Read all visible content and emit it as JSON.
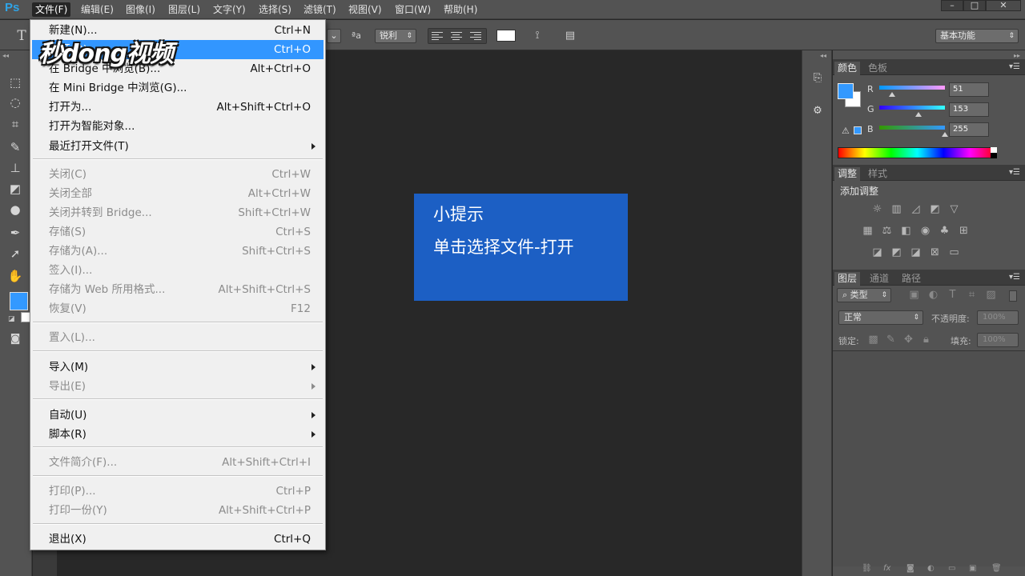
{
  "app": {
    "logo": "Ps",
    "menus": [
      "文件(F)",
      "编辑(E)",
      "图像(I)",
      "图层(L)",
      "文字(Y)",
      "选择(S)",
      "滤镜(T)",
      "视图(V)",
      "窗口(W)",
      "帮助(H)"
    ],
    "active_menu": "文件(F)",
    "window_controls": {
      "minimize": "–",
      "restore": "□",
      "close": "✕"
    }
  },
  "options_bar": {
    "text_tool": "T",
    "size_glyph": "ªa",
    "antialias": "锐利",
    "workspace": "基本功能"
  },
  "file_menu": {
    "items": [
      {
        "label": "新建(N)...",
        "shortcut": "Ctrl+N",
        "enabled": true
      },
      {
        "label": "打开(O)...",
        "shortcut": "Ctrl+O",
        "enabled": true,
        "highlighted": true
      },
      {
        "label": "在 Bridge 中浏览(B)...",
        "shortcut": "Alt+Ctrl+O",
        "enabled": true
      },
      {
        "label": "在 Mini Bridge 中浏览(G)...",
        "shortcut": "",
        "enabled": true
      },
      {
        "label": "打开为...",
        "shortcut": "Alt+Shift+Ctrl+O",
        "enabled": true
      },
      {
        "label": "打开为智能对象...",
        "shortcut": "",
        "enabled": true
      },
      {
        "label": "最近打开文件(T)",
        "shortcut": "",
        "enabled": true,
        "submenu": true
      },
      {
        "label": "关闭(C)",
        "shortcut": "Ctrl+W",
        "enabled": false
      },
      {
        "label": "关闭全部",
        "shortcut": "Alt+Ctrl+W",
        "enabled": false
      },
      {
        "label": "关闭并转到 Bridge...",
        "shortcut": "Shift+Ctrl+W",
        "enabled": false
      },
      {
        "label": "存储(S)",
        "shortcut": "Ctrl+S",
        "enabled": false
      },
      {
        "label": "存储为(A)...",
        "shortcut": "Shift+Ctrl+S",
        "enabled": false
      },
      {
        "label": "签入(I)...",
        "shortcut": "",
        "enabled": false
      },
      {
        "label": "存储为 Web 所用格式...",
        "shortcut": "Alt+Shift+Ctrl+S",
        "enabled": false
      },
      {
        "label": "恢复(V)",
        "shortcut": "F12",
        "enabled": false
      },
      {
        "label": "置入(L)...",
        "shortcut": "",
        "enabled": false
      },
      {
        "label": "导入(M)",
        "shortcut": "",
        "enabled": true,
        "submenu": true
      },
      {
        "label": "导出(E)",
        "shortcut": "",
        "enabled": false,
        "submenu": true
      },
      {
        "label": "自动(U)",
        "shortcut": "",
        "enabled": true,
        "submenu": true
      },
      {
        "label": "脚本(R)",
        "shortcut": "",
        "enabled": true,
        "submenu": true
      },
      {
        "label": "文件简介(F)...",
        "shortcut": "Alt+Shift+Ctrl+I",
        "enabled": false
      },
      {
        "label": "打印(P)...",
        "shortcut": "Ctrl+P",
        "enabled": false
      },
      {
        "label": "打印一份(Y)",
        "shortcut": "Alt+Shift+Ctrl+P",
        "enabled": false
      },
      {
        "label": "退出(X)",
        "shortcut": "Ctrl+Q",
        "enabled": true
      }
    ]
  },
  "watermark": "秒dong视频",
  "tip": {
    "title": "小提示",
    "text": "单击选择文件-打开"
  },
  "color_panel": {
    "tabs": [
      "颜色",
      "色板"
    ],
    "channels": [
      {
        "label": "R",
        "value": "51",
        "fraction": 0.2
      },
      {
        "label": "G",
        "value": "153",
        "fraction": 0.6
      },
      {
        "label": "B",
        "value": "255",
        "fraction": 1.0
      }
    ],
    "foreground": "#3399ff"
  },
  "adjust_panel": {
    "tabs": [
      "调整",
      "样式"
    ],
    "title": "添加调整"
  },
  "layers_panel": {
    "tabs": [
      "图层",
      "通道",
      "路径"
    ],
    "filter_kind": "类型",
    "blend_mode": "正常",
    "opacity_label": "不透明度:",
    "opacity_value": "100%",
    "lock_label": "锁定:",
    "fill_label": "填充:",
    "fill_value": "100%"
  },
  "colors": {
    "menu_highlight": "#3296ff",
    "tip_bg": "#1c5fc4",
    "chrome": "#535353",
    "canvas": "#282828"
  }
}
